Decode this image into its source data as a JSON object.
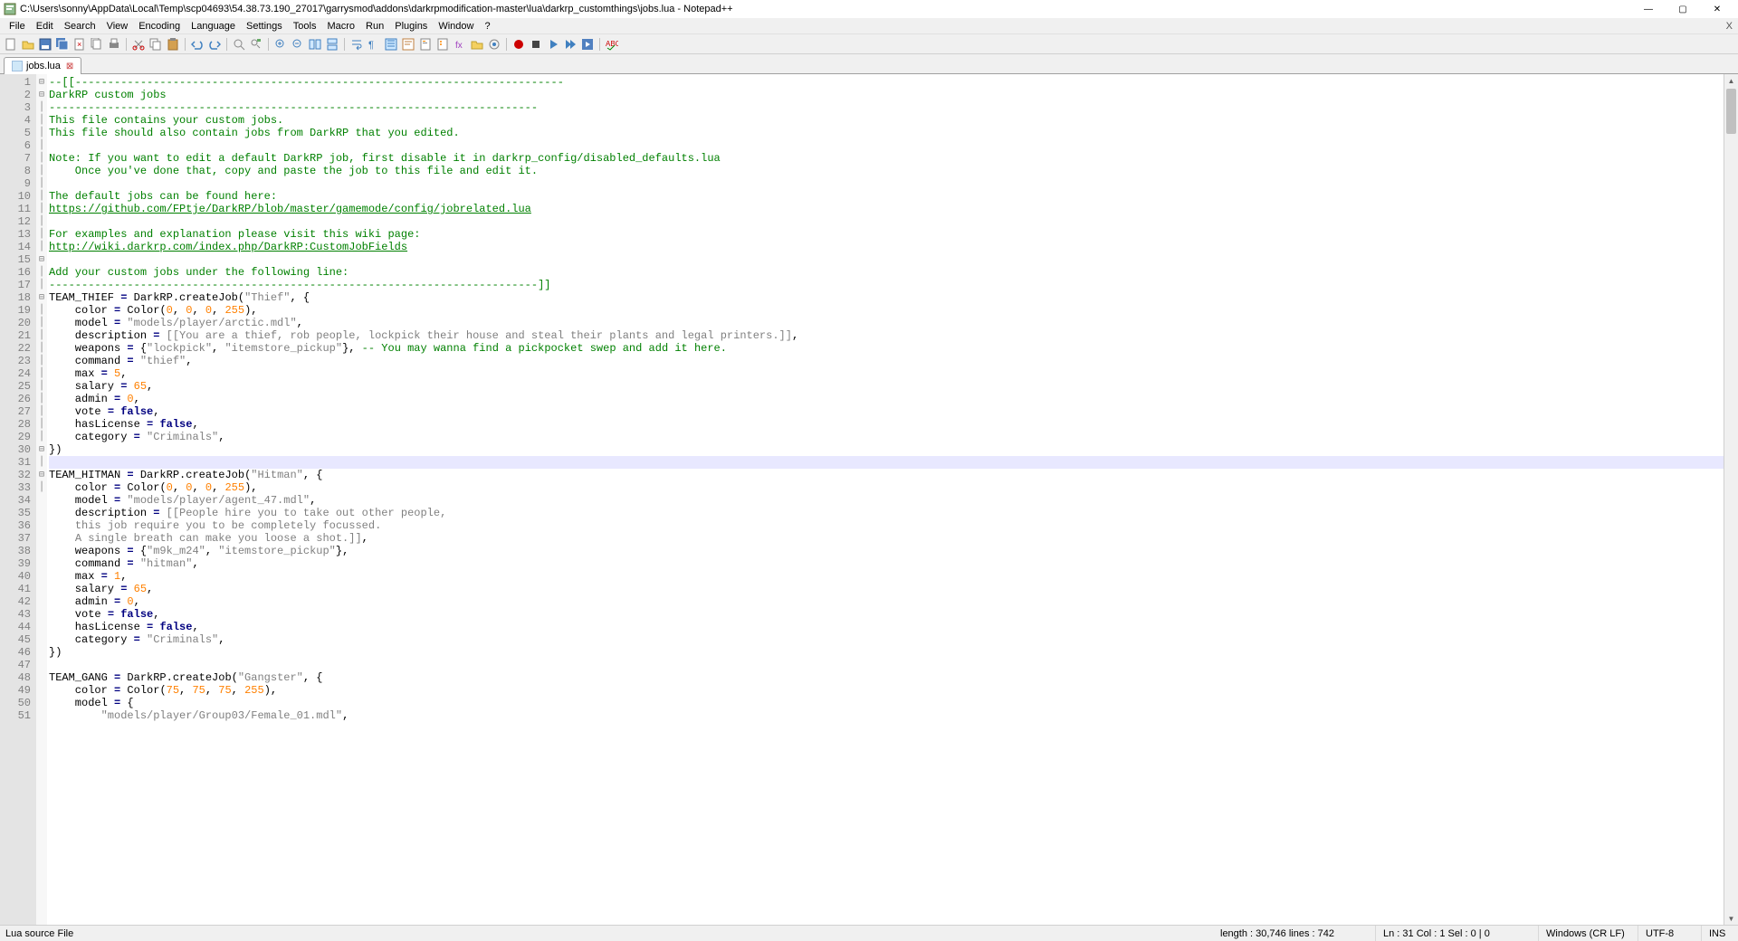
{
  "window": {
    "title": "C:\\Users\\sonny\\AppData\\Local\\Temp\\scp04693\\54.38.73.190_27017\\garrysmod\\addons\\darkrpmodification-master\\lua\\darkrp_customthings\\jobs.lua - Notepad++",
    "minimize": "—",
    "maximize": "▢",
    "close": "✕"
  },
  "menu": {
    "file": "File",
    "edit": "Edit",
    "search": "Search",
    "view": "View",
    "encoding": "Encoding",
    "language": "Language",
    "settings": "Settings",
    "tools": "Tools",
    "macro": "Macro",
    "run": "Run",
    "plugins": "Plugins",
    "window": "Window",
    "help": "?",
    "closex": "X"
  },
  "tabs": {
    "jobs": "jobs.lua"
  },
  "status": {
    "filetype": "Lua source File",
    "length": "length : 30,746    lines : 742",
    "pos": "Ln : 31    Col : 1    Sel : 0 | 0",
    "eol": "Windows (CR LF)",
    "enc": "UTF-8",
    "ins": "INS"
  },
  "code": {
    "l1": "--[[---------------------------------------------------------------------------",
    "l2": "DarkRP custom jobs",
    "l3": "---------------------------------------------------------------------------",
    "l4": "This file contains your custom jobs.",
    "l5": "This file should also contain jobs from DarkRP that you edited.",
    "l6": "",
    "l7": "Note: If you want to edit a default DarkRP job, first disable it in darkrp_config/disabled_defaults.lua",
    "l8": "    Once you've done that, copy and paste the job to this file and edit it.",
    "l9": "",
    "l10": "The default jobs can be found here:",
    "l11": "https://github.com/FPtje/DarkRP/blob/master/gamemode/config/jobrelated.lua",
    "l12": "",
    "l13": "For examples and explanation please visit this wiki page:",
    "l14": "http://wiki.darkrp.com/index.php/DarkRP:CustomJobFields",
    "l15": "",
    "l16": "Add your custom jobs under the following line:",
    "l17": "---------------------------------------------------------------------------]]",
    "thief_head_a": "TEAM_THIEF ",
    "thief_head_b": " DarkRP",
    "thief_head_c": "createJob",
    "thief_head_d": "\"Thief\"",
    "color_a": "    color ",
    "color_b": " Color",
    "t_model": "\"models/player/arctic.mdl\"",
    "t_desc": "[[You are a thief, rob people, lockpick their house and steal their plants and legal printers.]]",
    "t_wep1": "\"lockpick\"",
    "t_wep2": "\"itemstore_pickup\"",
    "t_wepcom": " -- You may wanna find a pickpocket swep and add it here.",
    "t_cmd": "\"thief\"",
    "t_max": "5",
    "t_sal": "65",
    "t_cat": "\"Criminals\"",
    "hit_head_d": "\"Hitman\"",
    "h_model": "\"models/player/agent_47.mdl\"",
    "h_desc1": "[[People hire you to take out other people,",
    "h_desc2": "this job require you to be completely focussed.",
    "h_desc3": "A single breath can make you loose a shot.]]",
    "h_wep1": "\"m9k_m24\"",
    "h_cmd": "\"hitman\"",
    "h_max": "1",
    "gang_head_d": "\"Gangster\"",
    "g_col": "75",
    "g_model": "\"models/player/Group03/Female_01.mdl\"",
    "kw_model": "    model ",
    "kw_desc": "    description ",
    "kw_wep": "    weapons ",
    "kw_cmd": "    command ",
    "kw_max": "    max ",
    "kw_sal": "    salary ",
    "kw_adm": "    admin ",
    "kw_vote": "    vote ",
    "kw_lic": "    hasLicense ",
    "kw_cat": "    category ",
    "zero": "0",
    "n255": "255",
    "false": "false",
    "close": "})",
    "eq": "="
  }
}
